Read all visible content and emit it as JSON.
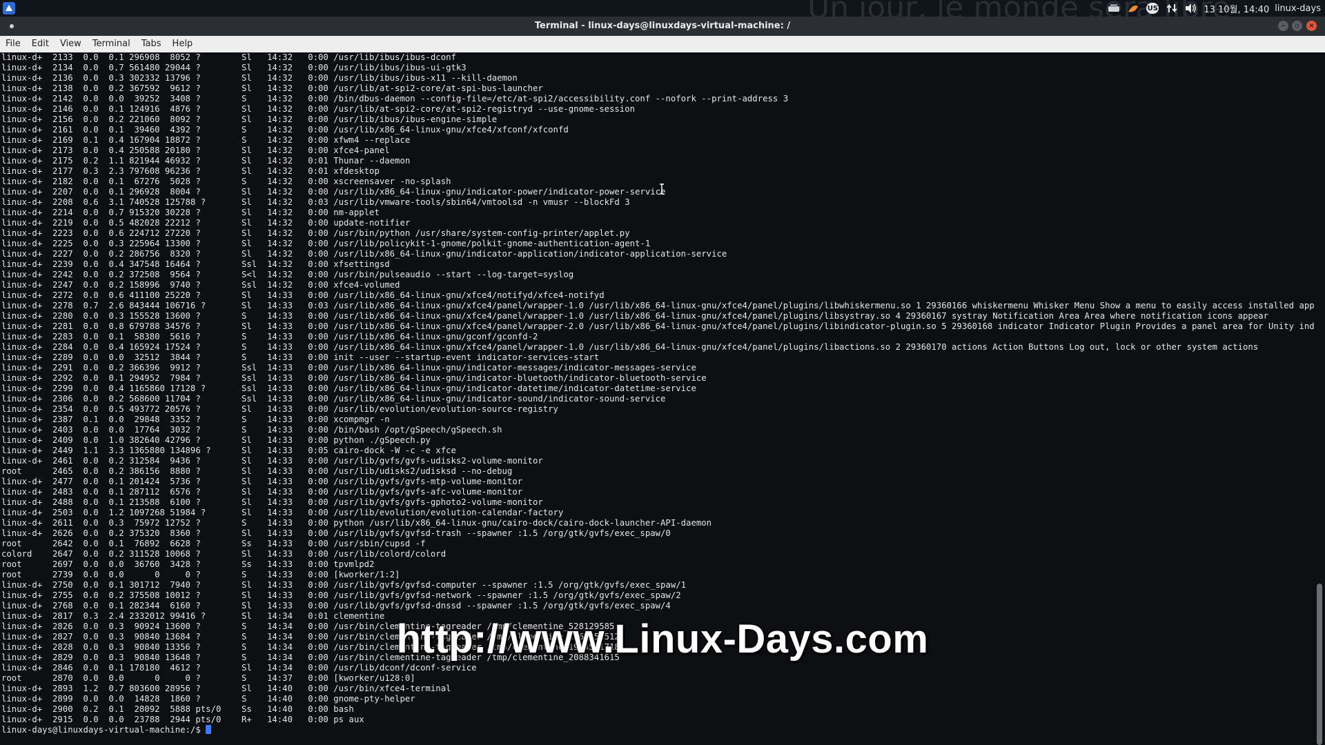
{
  "panel": {
    "watermark_text": "Un jour, le monde sera libre",
    "keyboard_layout": "US",
    "clock": "13 10월, 14:40",
    "user": "linux-days",
    "icons": [
      "distro-logo-icon",
      "network-icon",
      "cairo-dock-icon",
      "keyboard-icon",
      "transfer-arrows-icon",
      "volume-icon"
    ]
  },
  "window": {
    "title": "Terminal - linux-days@linuxdays-virtual-machine: /",
    "buttons": [
      "minimize",
      "maximize",
      "close"
    ]
  },
  "menubar": [
    "File",
    "Edit",
    "View",
    "Terminal",
    "Tabs",
    "Help"
  ],
  "terminal": {
    "lines": [
      "linux-d+  2133  0.0  0.1 296908  8052 ?        Sl   14:32   0:00 /usr/lib/ibus/ibus-dconf",
      "linux-d+  2134  0.0  0.7 561480 29044 ?        Sl   14:32   0:00 /usr/lib/ibus/ibus-ui-gtk3",
      "linux-d+  2136  0.0  0.3 302332 13796 ?        Sl   14:32   0:00 /usr/lib/ibus/ibus-x11 --kill-daemon",
      "linux-d+  2138  0.0  0.2 367592  9612 ?        Sl   14:32   0:00 /usr/lib/at-spi2-core/at-spi-bus-launcher",
      "linux-d+  2142  0.0  0.0  39252  3408 ?        S    14:32   0:00 /bin/dbus-daemon --config-file=/etc/at-spi2/accessibility.conf --nofork --print-address 3",
      "linux-d+  2146  0.0  0.1 124916  4876 ?        Sl   14:32   0:00 /usr/lib/at-spi2-core/at-spi2-registryd --use-gnome-session",
      "linux-d+  2156  0.0  0.2 221060  8092 ?        Sl   14:32   0:00 /usr/lib/ibus/ibus-engine-simple",
      "linux-d+  2161  0.0  0.1  39460  4392 ?        S    14:32   0:00 /usr/lib/x86_64-linux-gnu/xfce4/xfconf/xfconfd",
      "linux-d+  2169  0.1  0.4 167904 18872 ?        S    14:32   0:00 xfwm4 --replace",
      "linux-d+  2173  0.0  0.4 250588 20180 ?        Sl   14:32   0:00 xfce4-panel",
      "linux-d+  2175  0.2  1.1 821944 46932 ?        Sl   14:32   0:01 Thunar --daemon",
      "linux-d+  2177  0.3  2.3 797608 96236 ?        Sl   14:32   0:01 xfdesktop",
      "linux-d+  2182  0.0  0.1  67276  5028 ?        S    14:32   0:00 xscreensaver -no-splash",
      "linux-d+  2207  0.0  0.1 296928  8004 ?        Sl   14:32   0:00 /usr/lib/x86_64-linux-gnu/indicator-power/indicator-power-service",
      "linux-d+  2208  0.6  3.1 740528 125788 ?       Sl   14:32   0:03 /usr/lib/vmware-tools/sbin64/vmtoolsd -n vmusr --blockFd 3",
      "linux-d+  2214  0.0  0.7 915320 30228 ?        Sl   14:32   0:00 nm-applet",
      "linux-d+  2219  0.0  0.5 482028 22212 ?        Sl   14:32   0:00 update-notifier",
      "linux-d+  2223  0.0  0.6 224712 27220 ?        Sl   14:32   0:00 /usr/bin/python /usr/share/system-config-printer/applet.py",
      "linux-d+  2225  0.0  0.3 225964 13300 ?        Sl   14:32   0:00 /usr/lib/policykit-1-gnome/polkit-gnome-authentication-agent-1",
      "linux-d+  2227  0.0  0.2 286756  8320 ?        Sl   14:32   0:00 /usr/lib/x86_64-linux-gnu/indicator-application/indicator-application-service",
      "linux-d+  2239  0.0  0.4 347548 16464 ?        Ssl  14:32   0:00 xfsettingsd",
      "linux-d+  2242  0.0  0.2 372508  9564 ?        S<l  14:32   0:00 /usr/bin/pulseaudio --start --log-target=syslog",
      "linux-d+  2247  0.0  0.2 158996  9740 ?        Ssl  14:32   0:00 xfce4-volumed",
      "linux-d+  2272  0.0  0.6 411100 25220 ?        Sl   14:33   0:00 /usr/lib/x86_64-linux-gnu/xfce4/notifyd/xfce4-notifyd",
      "linux-d+  2278  0.7  2.6 843444 106716 ?       Sl   14:33   0:03 /usr/lib/x86_64-linux-gnu/xfce4/panel/wrapper-1.0 /usr/lib/x86_64-linux-gnu/xfce4/panel/plugins/libwhiskermenu.so 1 29360166 whiskermenu Whisker Menu Show a menu to easily access installed applications",
      "linux-d+  2280  0.0  0.3 155528 13600 ?        S    14:33   0:00 /usr/lib/x86_64-linux-gnu/xfce4/panel/wrapper-1.0 /usr/lib/x86_64-linux-gnu/xfce4/panel/plugins/libsystray.so 4 29360167 systray Notification Area Area where notification icons appear",
      "linux-d+  2281  0.0  0.8 679788 34576 ?        Sl   14:33   0:00 /usr/lib/x86_64-linux-gnu/xfce4/panel/wrapper-2.0 /usr/lib/x86_64-linux-gnu/xfce4/panel/plugins/libindicator-plugin.so 5 29360168 indicator Indicator Plugin Provides a panel area for Unity indicators. Indic",
      "linux-d+  2283  0.0  0.1  58380  5616 ?        S    14:33   0:00 /usr/lib/x86_64-linux-gnu/gconf/gconfd-2",
      "linux-d+  2284  0.0  0.4 165924 17524 ?        S    14:33   0:00 /usr/lib/x86_64-linux-gnu/xfce4/panel/wrapper-1.0 /usr/lib/x86_64-linux-gnu/xfce4/panel/plugins/libactions.so 2 29360170 actions Action Buttons Log out, lock or other system actions",
      "linux-d+  2289  0.0  0.0  32512  3844 ?        S    14:33   0:00 init --user --startup-event indicator-services-start",
      "linux-d+  2291  0.0  0.2 366396  9912 ?        Ssl  14:33   0:00 /usr/lib/x86_64-linux-gnu/indicator-messages/indicator-messages-service",
      "linux-d+  2292  0.0  0.1 294952  7984 ?        Ssl  14:33   0:00 /usr/lib/x86_64-linux-gnu/indicator-bluetooth/indicator-bluetooth-service",
      "linux-d+  2299  0.0  0.4 1165860 17128 ?       Ssl  14:33   0:00 /usr/lib/x86_64-linux-gnu/indicator-datetime/indicator-datetime-service",
      "linux-d+  2306  0.0  0.2 568600 11704 ?        Ssl  14:33   0:00 /usr/lib/x86_64-linux-gnu/indicator-sound/indicator-sound-service",
      "linux-d+  2354  0.0  0.5 493772 20576 ?        Sl   14:33   0:00 /usr/lib/evolution/evolution-source-registry",
      "linux-d+  2387  0.1  0.0  29848  3352 ?        S    14:33   0:00 xcompmgr -n",
      "linux-d+  2403  0.0  0.0  17764  3032 ?        S    14:33   0:00 /bin/bash /opt/gSpeech/gSpeech.sh",
      "linux-d+  2409  0.0  1.0 382640 42796 ?        Sl   14:33   0:00 python ./gSpeech.py",
      "linux-d+  2449  1.1  3.3 1365880 134896 ?      Sl   14:33   0:05 cairo-dock -W -c -e xfce",
      "linux-d+  2461  0.0  0.2 312584  9436 ?        Sl   14:33   0:00 /usr/lib/gvfs/gvfs-udisks2-volume-monitor",
      "root      2465  0.0  0.2 386156  8880 ?        Sl   14:33   0:00 /usr/lib/udisks2/udisksd --no-debug",
      "linux-d+  2477  0.0  0.1 201424  5736 ?        Sl   14:33   0:00 /usr/lib/gvfs/gvfs-mtp-volume-monitor",
      "linux-d+  2483  0.0  0.1 287112  6576 ?        Sl   14:33   0:00 /usr/lib/gvfs/gvfs-afc-volume-monitor",
      "linux-d+  2488  0.0  0.1 213588  6100 ?        Sl   14:33   0:00 /usr/lib/gvfs/gvfs-gphoto2-volume-monitor",
      "linux-d+  2503  0.0  1.2 1097268 51984 ?       Sl   14:33   0:00 /usr/lib/evolution/evolution-calendar-factory",
      "linux-d+  2611  0.0  0.3  75972 12752 ?        S    14:33   0:00 python /usr/lib/x86_64-linux-gnu/cairo-dock/cairo-dock-launcher-API-daemon",
      "linux-d+  2626  0.0  0.2 375320  8360 ?        Sl   14:33   0:00 /usr/lib/gvfs/gvfsd-trash --spawner :1.5 /org/gtk/gvfs/exec_spaw/0",
      "root      2642  0.0  0.1  76892  6628 ?        Ss   14:33   0:00 /usr/sbin/cupsd -f",
      "colord    2647  0.0  0.2 311528 10068 ?        Sl   14:33   0:00 /usr/lib/colord/colord",
      "root      2697  0.0  0.0  36760  3428 ?        Ss   14:33   0:00 tpvmlpd2",
      "root      2739  0.0  0.0      0     0 ?        S    14:33   0:00 [kworker/1:2]",
      "linux-d+  2750  0.0  0.1 301712  7940 ?        Sl   14:33   0:00 /usr/lib/gvfs/gvfsd-computer --spawner :1.5 /org/gtk/gvfs/exec_spaw/1",
      "linux-d+  2755  0.0  0.2 375508 10012 ?        Sl   14:33   0:00 /usr/lib/gvfs/gvfsd-network --spawner :1.5 /org/gtk/gvfs/exec_spaw/2",
      "linux-d+  2768  0.0  0.1 282344  6160 ?        Sl   14:33   0:00 /usr/lib/gvfs/gvfsd-dnssd --spawner :1.5 /org/gtk/gvfs/exec_spaw/4",
      "linux-d+  2817  0.3  2.4 2332012 99416 ?       Sl   14:34   0:01 clementine",
      "linux-d+  2826  0.0  0.3  90924 13600 ?        S    14:34   0:00 /usr/bin/clementine-tagreader /tmp/clementine_528129585",
      "linux-d+  2827  0.0  0.3  90840 13684 ?        S    14:34   0:00 /usr/bin/clementine-tagreader /tmp/clementine_1168253512",
      "linux-d+  2828  0.0  0.3  90840 13356 ?        S    14:34   0:00 /usr/bin/clementine-tagreader /tmp/clementine_1914521718",
      "linux-d+  2829  0.0  0.3  90840 13648 ?        S    14:34   0:00 /usr/bin/clementine-tagreader /tmp/clementine_2088341615",
      "linux-d+  2846  0.0  0.1 178180  4612 ?        Sl   14:34   0:00 /usr/lib/dconf/dconf-service",
      "root      2870  0.0  0.0      0     0 ?        S    14:37   0:00 [kworker/u128:0]",
      "linux-d+  2893  1.2  0.7 803600 28956 ?        Sl   14:40   0:00 /usr/bin/xfce4-terminal",
      "linux-d+  2899  0.0  0.0  14828  1860 ?        S    14:40   0:00 gnome-pty-helper",
      "linux-d+  2900  0.2  0.1  28092  5888 pts/0    Ss   14:40   0:00 bash",
      "linux-d+  2915  0.0  0.0  23788  2944 pts/0    R+   14:40   0:00 ps aux"
    ],
    "prompt": "linux-days@linuxdays-virtual-machine:/$ "
  },
  "overlay": {
    "url_text": "http://www.Linux-Days.com"
  }
}
